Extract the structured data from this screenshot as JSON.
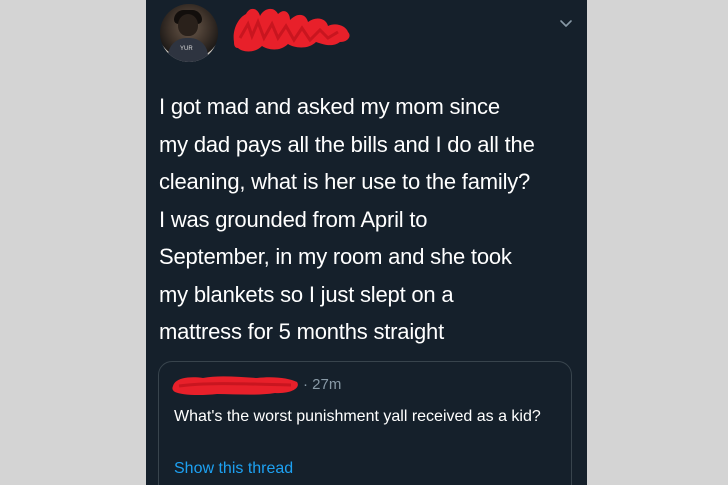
{
  "tweet": {
    "author_avatar_text": "YUR",
    "text": "I got mad and asked my mom since\nmy dad pays all the bills and I do all the\ncleaning, what is her use to the family?\nI was grounded from April to\nSeptember, in my room and she took\nmy blankets so I just slept on a\nmattress for 5 months straight"
  },
  "quoted_tweet": {
    "time": "· 27m",
    "text": "What's the worst punishment yall received as a kid?",
    "show_thread_label": "Show this thread"
  },
  "icons": {
    "more_menu": "chevron-down-icon"
  },
  "colors": {
    "background": "#15202b",
    "text": "#ffffff",
    "secondary_text": "#8899a6",
    "link": "#1da1f2",
    "redaction": "#e8202a",
    "page_margin": "#d4d4d4"
  }
}
